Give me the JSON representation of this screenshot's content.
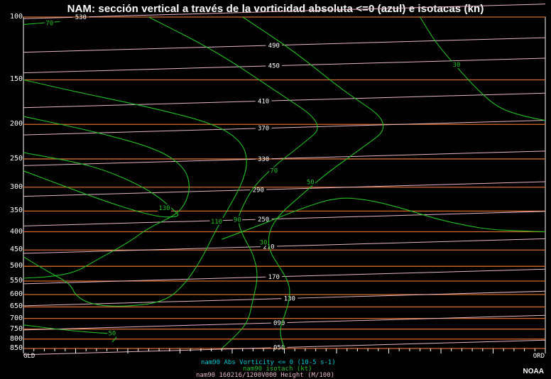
{
  "chart_data": {
    "type": "line",
    "title": "NAM: sección vertical a través de la vorticidad absoluta <=0 (azul) e isotacas (kn)",
    "y_axis": {
      "label": "",
      "scale": "log",
      "reversed": true,
      "ylim": [
        850,
        100
      ],
      "ticks": [
        "100",
        "150",
        "200",
        "250",
        "300",
        "350",
        "400",
        "450",
        "500",
        "550",
        "600",
        "650",
        "700",
        "750",
        "800",
        "850"
      ]
    },
    "x_axis": {
      "label": "",
      "start_label": "GLD",
      "end_label": "ORD",
      "xlim": [
        0,
        1
      ]
    },
    "pressure_levels_hpa": [
      100,
      150,
      200,
      250,
      300,
      350,
      400,
      450,
      500,
      550,
      600,
      650,
      700,
      750,
      800,
      850
    ],
    "height_contour_labels": [
      {
        "label": "530",
        "p": 100,
        "x": 0.11
      },
      {
        "label": "490",
        "p": 120,
        "x": 0.48
      },
      {
        "label": "450",
        "p": 137,
        "x": 0.48
      },
      {
        "label": "410",
        "p": 172,
        "x": 0.46
      },
      {
        "label": "370",
        "p": 205,
        "x": 0.46
      },
      {
        "label": "330",
        "p": 250,
        "x": 0.46
      },
      {
        "label": "290",
        "p": 305,
        "x": 0.45
      },
      {
        "label": "250",
        "p": 369,
        "x": 0.46
      },
      {
        "label": "210",
        "p": 440,
        "x": 0.47
      },
      {
        "label": "170",
        "p": 535,
        "x": 0.48
      },
      {
        "label": "130",
        "p": 615,
        "x": 0.51
      },
      {
        "label": "090",
        "p": 720,
        "x": 0.49
      },
      {
        "label": "050",
        "p": 845,
        "x": 0.49
      }
    ],
    "isotach_labels": [
      {
        "label": "70",
        "p": 104,
        "x": 0.05
      },
      {
        "label": "30",
        "p": 136,
        "x": 0.83
      },
      {
        "label": "70",
        "p": 270,
        "x": 0.48
      },
      {
        "label": "50",
        "p": 290,
        "x": 0.55
      },
      {
        "label": "130",
        "p": 343,
        "x": 0.27
      },
      {
        "label": "110",
        "p": 374,
        "x": 0.37
      },
      {
        "label": "90",
        "p": 370,
        "x": 0.41
      },
      {
        "label": "30",
        "p": 428,
        "x": 0.46
      },
      {
        "label": "50",
        "p": 770,
        "x": 0.17
      }
    ],
    "isotachs": [
      {
        "value": 30,
        "points": [
          [
            0.76,
            100
          ],
          [
            0.79,
            118
          ],
          [
            0.83,
            138
          ],
          [
            0.87,
            160
          ],
          [
            0.91,
            180
          ],
          [
            0.96,
            190
          ],
          [
            1.0,
            195
          ]
        ]
      },
      {
        "value": 50,
        "points": [
          [
            0.42,
            100
          ],
          [
            0.52,
            125
          ],
          [
            0.61,
            160
          ],
          [
            0.71,
            200
          ],
          [
            0.64,
            238
          ],
          [
            0.58,
            275
          ],
          [
            0.53,
            318
          ],
          [
            0.49,
            358
          ],
          [
            0.47,
            400
          ],
          [
            0.47,
            450
          ],
          [
            0.49,
            500
          ],
          [
            0.51,
            560
          ],
          [
            0.51,
            620
          ],
          [
            0.5,
            690
          ],
          [
            0.49,
            760
          ],
          [
            0.5,
            850
          ]
        ]
      },
      {
        "value": 50,
        "points": [
          [
            0.0,
            730
          ],
          [
            0.08,
            755
          ],
          [
            0.14,
            768
          ],
          [
            0.17,
            772
          ],
          [
            0.18,
            790
          ],
          [
            0.17,
            815
          ]
        ]
      },
      {
        "value": 70,
        "points": [
          [
            0.24,
            100
          ],
          [
            0.37,
            125
          ],
          [
            0.48,
            160
          ],
          [
            0.58,
            200
          ],
          [
            0.53,
            230
          ],
          [
            0.48,
            262
          ],
          [
            0.44,
            300
          ],
          [
            0.42,
            340
          ],
          [
            0.41,
            370
          ],
          [
            0.42,
            410
          ],
          [
            0.44,
            460
          ],
          [
            0.45,
            530
          ],
          [
            0.44,
            620
          ],
          [
            0.43,
            720
          ],
          [
            0.4,
            800
          ],
          [
            0.38,
            850
          ]
        ]
      },
      {
        "value": 70,
        "points": [
          [
            0.0,
            105
          ],
          [
            0.03,
            104
          ],
          [
            0.07,
            103
          ]
        ]
      },
      {
        "value": 90,
        "points": [
          [
            0.0,
            150
          ],
          [
            0.1,
            162
          ],
          [
            0.25,
            180
          ],
          [
            0.37,
            200
          ],
          [
            0.42,
            225
          ],
          [
            0.43,
            255
          ],
          [
            0.42,
            290
          ],
          [
            0.4,
            330
          ],
          [
            0.38,
            370
          ],
          [
            0.36,
            420
          ],
          [
            0.34,
            480
          ],
          [
            0.31,
            560
          ],
          [
            0.27,
            630
          ],
          [
            0.19,
            650
          ],
          [
            0.13,
            640
          ],
          [
            0.1,
            605
          ],
          [
            0.09,
            560
          ],
          [
            0.05,
            520
          ],
          [
            0.02,
            490
          ],
          [
            0.0,
            470
          ]
        ]
      },
      {
        "value": 110,
        "points": [
          [
            0.0,
            190
          ],
          [
            0.14,
            210
          ],
          [
            0.26,
            235
          ],
          [
            0.31,
            265
          ],
          [
            0.32,
            300
          ],
          [
            0.31,
            335
          ],
          [
            0.29,
            360
          ],
          [
            0.24,
            390
          ],
          [
            0.2,
            430
          ],
          [
            0.14,
            480
          ],
          [
            0.1,
            520
          ],
          [
            0.05,
            535
          ],
          [
            0.0,
            540
          ]
        ]
      },
      {
        "value": 130,
        "points": [
          [
            0.0,
            240
          ],
          [
            0.1,
            255
          ],
          [
            0.16,
            270
          ],
          [
            0.22,
            295
          ],
          [
            0.26,
            320
          ],
          [
            0.29,
            350
          ],
          [
            0.3,
            362
          ],
          [
            0.27,
            365
          ],
          [
            0.23,
            355
          ],
          [
            0.16,
            330
          ],
          [
            0.07,
            295
          ],
          [
            0.0,
            270
          ]
        ]
      },
      {
        "value": 30,
        "points": [
          [
            0.38,
            420
          ],
          [
            0.46,
            380
          ],
          [
            0.53,
            345
          ],
          [
            0.6,
            320
          ],
          [
            0.66,
            325
          ],
          [
            0.73,
            345
          ],
          [
            0.79,
            368
          ],
          [
            0.85,
            385
          ],
          [
            0.9,
            395
          ],
          [
            0.96,
            398
          ],
          [
            1.0,
            400
          ]
        ]
      }
    ],
    "legend": [
      "nam90 Abs Vorticity <= 0 (10-5 s-1)",
      "nam90 isotach (kt)",
      "nam90 160216/1200V000 Height (M/100)"
    ]
  },
  "footer": {
    "credit": "NOAA"
  },
  "colors": {
    "background": "#000000",
    "pressure_lines": "#d46a2a",
    "height_contours": "#e6b7c5",
    "isotachs": "#22c022",
    "vorticity_legend": "#00c8d6",
    "text": "#ffffff"
  }
}
